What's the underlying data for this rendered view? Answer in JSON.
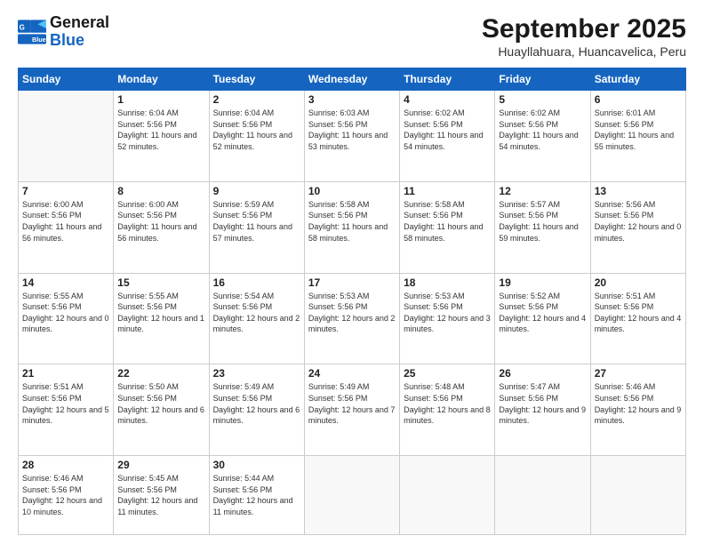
{
  "logo": {
    "line1": "General",
    "line2": "Blue"
  },
  "title": "September 2025",
  "location": "Huayllahuara, Huancavelica, Peru",
  "days_of_week": [
    "Sunday",
    "Monday",
    "Tuesday",
    "Wednesday",
    "Thursday",
    "Friday",
    "Saturday"
  ],
  "weeks": [
    [
      {
        "num": "",
        "empty": true
      },
      {
        "num": "1",
        "sunrise": "6:04 AM",
        "sunset": "5:56 PM",
        "daylight": "11 hours and 52 minutes."
      },
      {
        "num": "2",
        "sunrise": "6:04 AM",
        "sunset": "5:56 PM",
        "daylight": "11 hours and 52 minutes."
      },
      {
        "num": "3",
        "sunrise": "6:03 AM",
        "sunset": "5:56 PM",
        "daylight": "11 hours and 53 minutes."
      },
      {
        "num": "4",
        "sunrise": "6:02 AM",
        "sunset": "5:56 PM",
        "daylight": "11 hours and 54 minutes."
      },
      {
        "num": "5",
        "sunrise": "6:02 AM",
        "sunset": "5:56 PM",
        "daylight": "11 hours and 54 minutes."
      },
      {
        "num": "6",
        "sunrise": "6:01 AM",
        "sunset": "5:56 PM",
        "daylight": "11 hours and 55 minutes."
      }
    ],
    [
      {
        "num": "7",
        "sunrise": "6:00 AM",
        "sunset": "5:56 PM",
        "daylight": "11 hours and 56 minutes."
      },
      {
        "num": "8",
        "sunrise": "6:00 AM",
        "sunset": "5:56 PM",
        "daylight": "11 hours and 56 minutes."
      },
      {
        "num": "9",
        "sunrise": "5:59 AM",
        "sunset": "5:56 PM",
        "daylight": "11 hours and 57 minutes."
      },
      {
        "num": "10",
        "sunrise": "5:58 AM",
        "sunset": "5:56 PM",
        "daylight": "11 hours and 58 minutes."
      },
      {
        "num": "11",
        "sunrise": "5:58 AM",
        "sunset": "5:56 PM",
        "daylight": "11 hours and 58 minutes."
      },
      {
        "num": "12",
        "sunrise": "5:57 AM",
        "sunset": "5:56 PM",
        "daylight": "11 hours and 59 minutes."
      },
      {
        "num": "13",
        "sunrise": "5:56 AM",
        "sunset": "5:56 PM",
        "daylight": "12 hours and 0 minutes."
      }
    ],
    [
      {
        "num": "14",
        "sunrise": "5:55 AM",
        "sunset": "5:56 PM",
        "daylight": "12 hours and 0 minutes."
      },
      {
        "num": "15",
        "sunrise": "5:55 AM",
        "sunset": "5:56 PM",
        "daylight": "12 hours and 1 minute."
      },
      {
        "num": "16",
        "sunrise": "5:54 AM",
        "sunset": "5:56 PM",
        "daylight": "12 hours and 2 minutes."
      },
      {
        "num": "17",
        "sunrise": "5:53 AM",
        "sunset": "5:56 PM",
        "daylight": "12 hours and 2 minutes."
      },
      {
        "num": "18",
        "sunrise": "5:53 AM",
        "sunset": "5:56 PM",
        "daylight": "12 hours and 3 minutes."
      },
      {
        "num": "19",
        "sunrise": "5:52 AM",
        "sunset": "5:56 PM",
        "daylight": "12 hours and 4 minutes."
      },
      {
        "num": "20",
        "sunrise": "5:51 AM",
        "sunset": "5:56 PM",
        "daylight": "12 hours and 4 minutes."
      }
    ],
    [
      {
        "num": "21",
        "sunrise": "5:51 AM",
        "sunset": "5:56 PM",
        "daylight": "12 hours and 5 minutes."
      },
      {
        "num": "22",
        "sunrise": "5:50 AM",
        "sunset": "5:56 PM",
        "daylight": "12 hours and 6 minutes."
      },
      {
        "num": "23",
        "sunrise": "5:49 AM",
        "sunset": "5:56 PM",
        "daylight": "12 hours and 6 minutes."
      },
      {
        "num": "24",
        "sunrise": "5:49 AM",
        "sunset": "5:56 PM",
        "daylight": "12 hours and 7 minutes."
      },
      {
        "num": "25",
        "sunrise": "5:48 AM",
        "sunset": "5:56 PM",
        "daylight": "12 hours and 8 minutes."
      },
      {
        "num": "26",
        "sunrise": "5:47 AM",
        "sunset": "5:56 PM",
        "daylight": "12 hours and 9 minutes."
      },
      {
        "num": "27",
        "sunrise": "5:46 AM",
        "sunset": "5:56 PM",
        "daylight": "12 hours and 9 minutes."
      }
    ],
    [
      {
        "num": "28",
        "sunrise": "5:46 AM",
        "sunset": "5:56 PM",
        "daylight": "12 hours and 10 minutes."
      },
      {
        "num": "29",
        "sunrise": "5:45 AM",
        "sunset": "5:56 PM",
        "daylight": "12 hours and 11 minutes."
      },
      {
        "num": "30",
        "sunrise": "5:44 AM",
        "sunset": "5:56 PM",
        "daylight": "12 hours and 11 minutes."
      },
      {
        "num": "",
        "empty": true
      },
      {
        "num": "",
        "empty": true
      },
      {
        "num": "",
        "empty": true
      },
      {
        "num": "",
        "empty": true
      }
    ]
  ]
}
